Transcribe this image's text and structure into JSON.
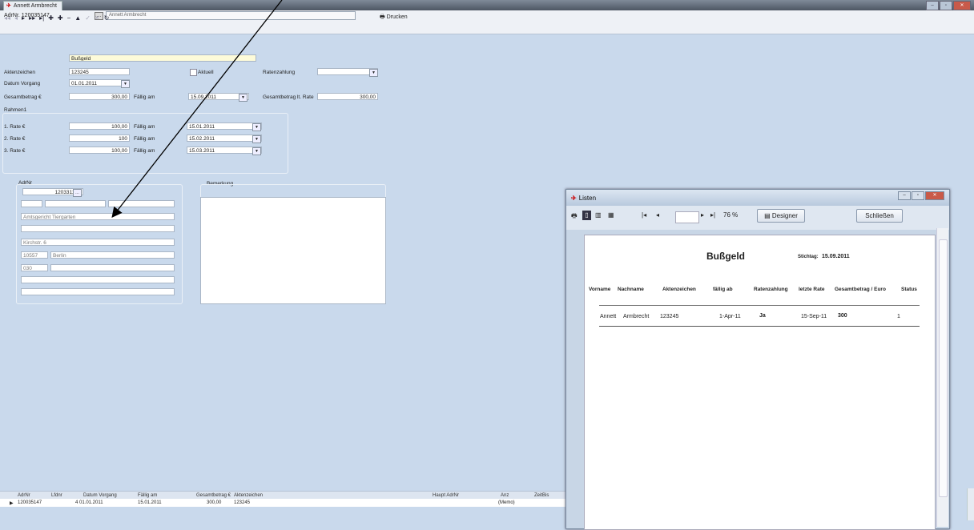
{
  "window": {
    "title": "Annett Armbrecht",
    "controls": [
      "–",
      "▫",
      "✕"
    ]
  },
  "address": {
    "label": "AdrNr. 120035147",
    "name": "Annett Armbrecht"
  },
  "toolbar": {
    "print_label": "Drucken"
  },
  "form": {
    "title_value": "Bußgeld",
    "aktenzeichen_label": "Aktenzeichen",
    "aktenzeichen_value": "123245",
    "aktuell_label": "Aktuell",
    "ratenzahlung_label": "Ratenzahlung",
    "datum_vorgang_label": "Datum Vorgang",
    "datum_vorgang_value": "01.01.2011",
    "gesamtbetrag_label": "Gesamtbetrag €",
    "gesamtbetrag_value": "300,00",
    "faellig_label": "Fällig am",
    "faellig_value": "15.09.2011",
    "gesamtbetrag_rate_label": "Gesamtbetrag lt. Rate",
    "gesamtbetrag_rate_value": "300,00",
    "rahmen_label": "Rahmen1",
    "rates": [
      {
        "label": "1. Rate €",
        "amount": "100,00",
        "due_label": "Fällig am",
        "due": "15.01.2011"
      },
      {
        "label": "2. Rate €",
        "amount": "100",
        "due_label": "Fällig am",
        "due": "15.02.2011"
      },
      {
        "label": "3. Rate €",
        "amount": "100,00",
        "due_label": "Fällig am",
        "due": "15.03.2011"
      }
    ],
    "adrnr_label": "AdrNr",
    "adrnr_value": "120331276",
    "address_fields": [
      "Amtsgericht Tiergarten",
      "Kirchstr. 6",
      "10557",
      "Berlin",
      "030"
    ],
    "bemerkung_label": "Bemerkung"
  },
  "grid": {
    "headers": [
      "AdrNr",
      "Lfdnr",
      "Datum Vorgang",
      "Fällig am",
      "Gesamtbetrag €",
      "Aktenzeichen",
      "Haupt AdrNr",
      "Anz",
      "ZeitBis"
    ],
    "row": [
      "120035147",
      "4",
      "01.01.2011",
      "15.01.2011",
      "300,00",
      "123245",
      "",
      "(Memo)",
      ""
    ]
  },
  "listen": {
    "title": "Listen",
    "zoom": "76 %",
    "designer_label": "Designer",
    "close_label": "Schließen",
    "report": {
      "title": "Bußgeld",
      "stichtag_label": "Stichtag:",
      "stichtag_value": "15.09.2011",
      "columns": [
        "Vorname",
        "Nachname",
        "Aktenzeichen",
        "fällig ab",
        "Ratenzahlung",
        "letzte Rate",
        "Gesamtbetrag / Euro",
        "Status"
      ],
      "row": [
        "Annett",
        "Armbrecht",
        "123245",
        "1-Apr-11",
        "Ja",
        "15-Sep-11",
        "300",
        "1"
      ]
    }
  }
}
